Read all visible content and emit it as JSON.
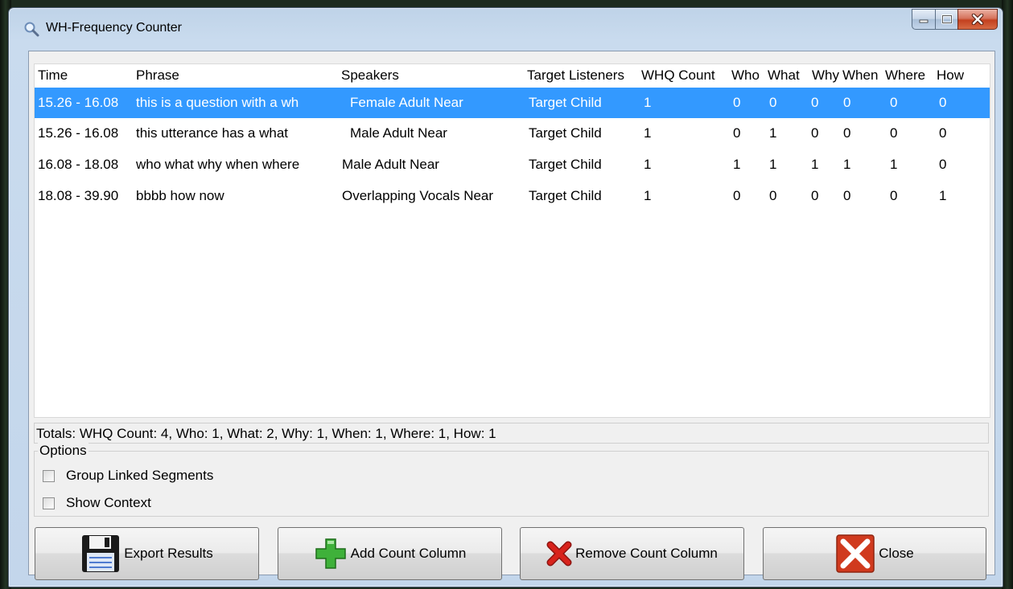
{
  "window": {
    "title": "WH-Frequency Counter"
  },
  "table": {
    "columns": [
      "Time",
      "Phrase",
      "Speakers",
      "Target Listeners",
      "WHQ Count",
      "Who",
      "What",
      "Why",
      "When",
      "Where",
      "How"
    ],
    "rows": [
      [
        "15.26 - 16.08",
        "this is a question with a wh",
        "Female Adult Near",
        "Target Child",
        "1",
        "0",
        "0",
        "0",
        "0",
        "0",
        "0"
      ],
      [
        "15.26 - 16.08",
        "this utterance has a what",
        "Male Adult Near",
        "Target Child",
        "1",
        "0",
        "1",
        "0",
        "0",
        "0",
        "0"
      ],
      [
        "16.08 - 18.08",
        "who what why when where",
        "Male Adult Near",
        "Target Child",
        "1",
        "1",
        "1",
        "1",
        "1",
        "1",
        "0"
      ],
      [
        "18.08 - 39.90",
        "bbbb how now",
        "Overlapping Vocals Near",
        "Target Child",
        "1",
        "0",
        "0",
        "0",
        "0",
        "0",
        "1"
      ]
    ],
    "selected_row": 0
  },
  "totals": "Totals: WHQ Count: 4, Who: 1, What: 2, Why: 1, When: 1, Where: 1, How: 1",
  "options": {
    "legend": "Options",
    "group_linked_segments": {
      "label": "Group Linked Segments",
      "checked": false
    },
    "show_context": {
      "label": "Show Context",
      "checked": false
    }
  },
  "buttons": {
    "export": "Export Results",
    "add_column": "Add Count Column",
    "remove_column": "Remove Count Column",
    "close": "Close"
  },
  "colors": {
    "selection": "#3399ff",
    "add_icon": "#3fb13a",
    "remove_icon": "#d8231c",
    "close_icon": "#d03a1e"
  },
  "icons": {
    "app": "magnifier-icon",
    "export": "floppy-disk-icon",
    "add_column": "green-plus-icon",
    "remove_column": "red-x-icon",
    "close": "close-box-icon"
  }
}
